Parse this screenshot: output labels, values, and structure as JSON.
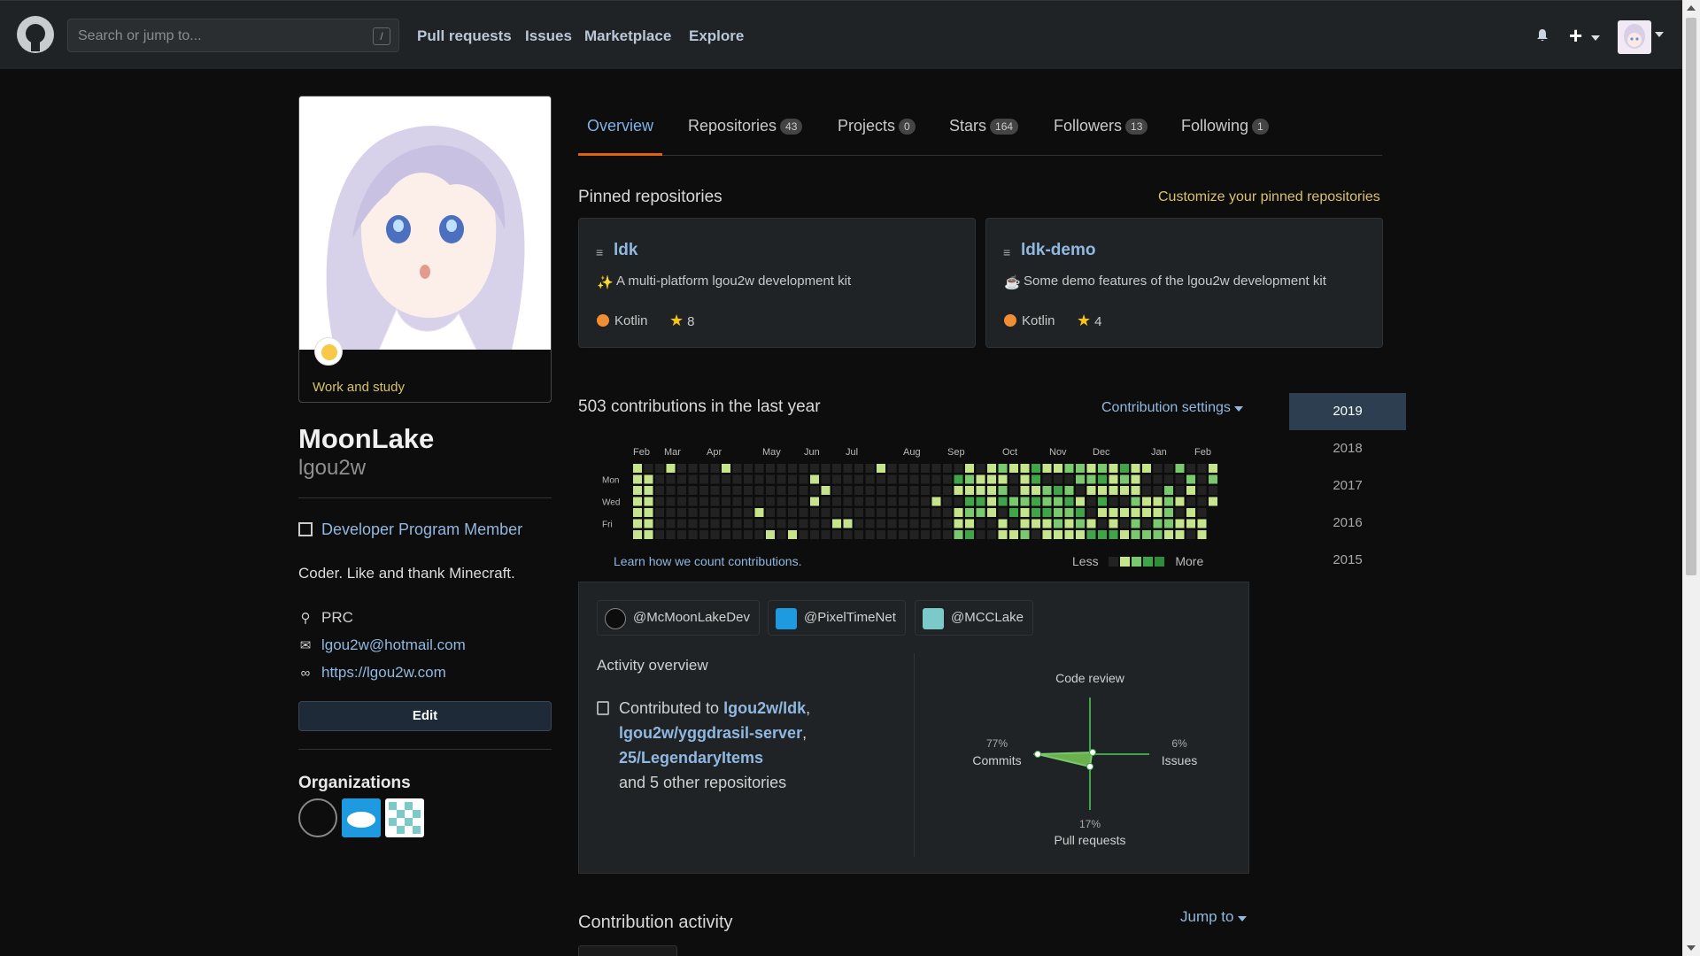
{
  "header": {
    "search_placeholder": "Search or jump to...",
    "search_shortcut": "/",
    "nav": [
      "Pull requests",
      "Issues",
      "Marketplace",
      "Explore"
    ]
  },
  "profile": {
    "status": "Work and study",
    "name": "MoonLake",
    "login": "lgou2w",
    "badge": "Developer Program Member",
    "bio": "Coder. Like and thank Minecraft.",
    "location": "PRC",
    "email": "lgou2w@hotmail.com",
    "website": "https://lgou2w.com",
    "edit_label": "Edit",
    "orgs_title": "Organizations"
  },
  "tabs": [
    {
      "label": "Overview",
      "count": ""
    },
    {
      "label": "Repositories",
      "count": "43"
    },
    {
      "label": "Projects",
      "count": "0"
    },
    {
      "label": "Stars",
      "count": "164"
    },
    {
      "label": "Followers",
      "count": "13"
    },
    {
      "label": "Following",
      "count": "1"
    }
  ],
  "pinned": {
    "title": "Pinned repositories",
    "customize": "Customize your pinned repositories",
    "repos": [
      {
        "name": "ldk",
        "desc": "A multi-platform lgou2w development kit",
        "lang": "Kotlin",
        "stars": "8"
      },
      {
        "name": "ldk-demo",
        "desc": "Some demo features of the lgou2w development kit",
        "lang": "Kotlin",
        "stars": "4"
      }
    ]
  },
  "contributions": {
    "title": "503 contributions in the last year",
    "settings": "Contribution settings",
    "months": [
      "Feb",
      "Mar",
      "Apr",
      "May",
      "Jun",
      "Jul",
      "Aug",
      "Sep",
      "Oct",
      "Nov",
      "Dec",
      "Jan",
      "Feb"
    ],
    "days": [
      "Mon",
      "Wed",
      "Fri"
    ],
    "learn": "Learn how we count contributions.",
    "less": "Less",
    "more": "More",
    "colors": [
      "#222",
      "#c6e48b",
      "#7bc96f",
      "#3fa548",
      "#2f8c3a"
    ]
  },
  "years": [
    "2019",
    "2018",
    "2017",
    "2016",
    "2015"
  ],
  "activity": {
    "orgs": [
      "@McMoonLakeDev",
      "@PixelTimeNet",
      "@MCCLake"
    ],
    "title": "Activity overview",
    "contributed_to": "Contributed to",
    "repos": [
      "lgou2w/ldk",
      "lgou2w/yggdrasil-server",
      "25/LegendaryItems"
    ],
    "others": "and 5 other repositories",
    "radar": {
      "code_review": "Code review",
      "commits_pct": "77%",
      "commits": "Commits",
      "issues_pct": "6%",
      "issues": "Issues",
      "pr_pct": "17%",
      "pull_requests": "Pull requests"
    }
  },
  "contribution_activity": {
    "title": "Contribution activity",
    "jump": "Jump to"
  }
}
